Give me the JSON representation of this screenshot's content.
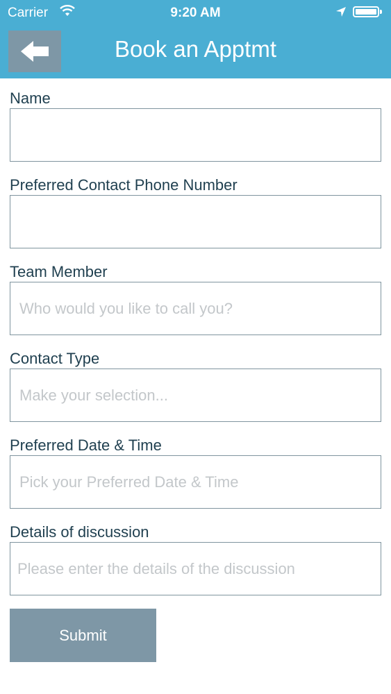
{
  "status_bar": {
    "carrier": "Carrier",
    "time": "9:20 AM"
  },
  "header": {
    "title": "Book an Apptmt",
    "background_color": "#4aaed3",
    "back_icon": "back-arrow-icon"
  },
  "form": {
    "name": {
      "label": "Name",
      "value": ""
    },
    "phone": {
      "label": "Preferred Contact Phone Number",
      "value": ""
    },
    "team_member": {
      "label": "Team Member",
      "placeholder": "Who would you like to call you?"
    },
    "contact_type": {
      "label": "Contact Type",
      "placeholder": "Make your selection..."
    },
    "preferred_datetime": {
      "label": "Preferred Date & Time",
      "placeholder": "Pick your Preferred Date & Time"
    },
    "details": {
      "label": "Details of discussion",
      "placeholder": "Please enter the details of the discussion"
    }
  },
  "submit": {
    "label": "Submit",
    "color": "#7e97a6"
  }
}
